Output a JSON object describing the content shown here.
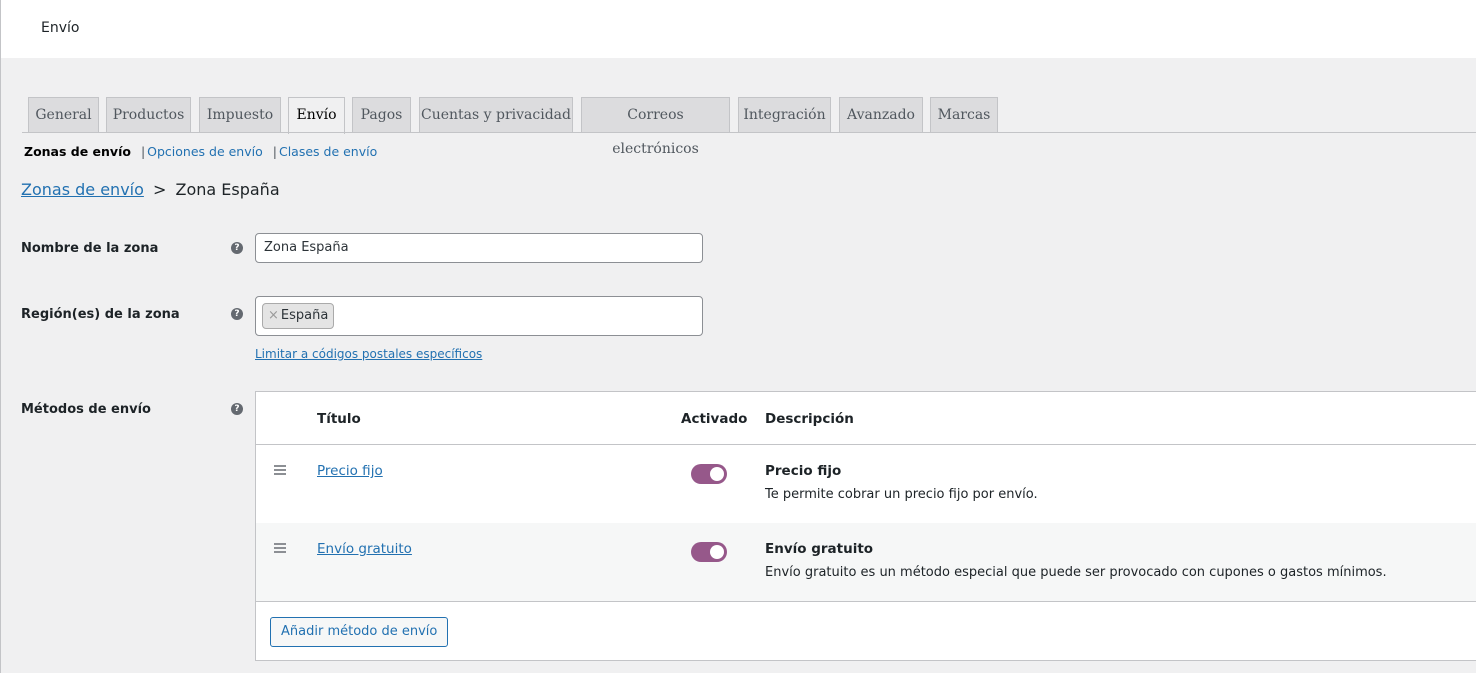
{
  "page": {
    "title": "Envío"
  },
  "tabs": [
    {
      "label": "General"
    },
    {
      "label": "Productos"
    },
    {
      "label": "Impuesto"
    },
    {
      "label": "Envío",
      "active": true
    },
    {
      "label": "Pagos"
    },
    {
      "label": "Cuentas y privacidad"
    },
    {
      "label": "Correos electrónicos"
    },
    {
      "label": "Integración"
    },
    {
      "label": "Avanzado"
    },
    {
      "label": "Marcas"
    }
  ],
  "subnav": {
    "current": "Zonas de envío",
    "links": [
      "Opciones de envío",
      "Clases de envío"
    ],
    "separator": "|"
  },
  "breadcrumb": {
    "parent": "Zonas de envío",
    "arrow": ">",
    "current": "Zona España"
  },
  "form": {
    "zone_name_label": "Nombre de la zona",
    "zone_name_value": "Zona España",
    "regions_label": "Región(es) de la zona",
    "regions": [
      {
        "remove": "×",
        "name": "España"
      }
    ],
    "postcode_link": "Limitar a códigos postales específicos",
    "methods_label": "Métodos de envío",
    "help_glyph": "?"
  },
  "methods_table": {
    "headers": {
      "title": "Título",
      "enabled": "Activado",
      "description": "Descripción"
    },
    "rows": [
      {
        "title": "Precio fijo",
        "enabled": true,
        "desc_title": "Precio fijo",
        "desc": "Te permite cobrar un precio fijo por envío."
      },
      {
        "title": "Envío gratuito",
        "enabled": true,
        "desc_title": "Envío gratuito",
        "desc": "Envío gratuito es un método especial que puede ser provocado con cupones o gastos mínimos."
      }
    ],
    "add_button": "Añadir método de envío"
  },
  "colors": {
    "accent": "#2271b1",
    "toggle_on": "#96588a",
    "background": "#f0f0f1"
  },
  "icons": {
    "help": "help-icon",
    "drag": "drag-handle-icon",
    "remove": "close-icon"
  }
}
